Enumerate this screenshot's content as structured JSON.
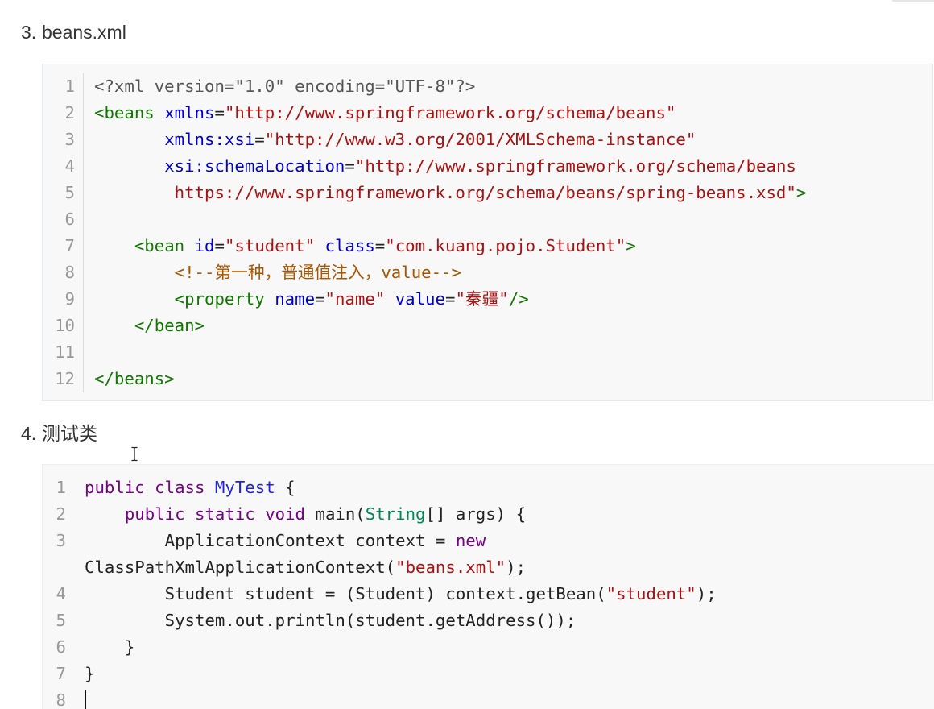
{
  "theme": {
    "page_background": "#ffffff",
    "text": "#333333",
    "code_background": "#f8f8f8",
    "code_border": "#e7eaed",
    "line_number": "#999999",
    "gutter_border": "#dddddd"
  },
  "document": {
    "sections": [
      {
        "marker": "3.",
        "title": "beans.xml",
        "code": {
          "lines": [
            {
              "n": 1,
              "tokens": [
                [
                  "<?xml version=\"1.0\" encoding=\"UTF-8\"?>",
                  "#555555"
                ]
              ]
            },
            {
              "n": 2,
              "tokens": [
                [
                  "<beans",
                  "#117700"
                ],
                [
                  " xmlns",
                  "#0000cc"
                ],
                [
                  "=",
                  "#222222"
                ],
                [
                  "\"http://www.springframework.org/schema/beans\"",
                  "#aa1111"
                ]
              ]
            },
            {
              "n": 3,
              "tokens": [
                [
                  "       xmlns:xsi",
                  "#0000cc"
                ],
                [
                  "=",
                  "#222222"
                ],
                [
                  "\"http://www.w3.org/2001/XMLSchema-instance\"",
                  "#aa1111"
                ]
              ]
            },
            {
              "n": 4,
              "tokens": [
                [
                  "       xsi:schemaLocation",
                  "#0000cc"
                ],
                [
                  "=",
                  "#222222"
                ],
                [
                  "\"http://www.springframework.org/schema/beans",
                  "#aa1111"
                ]
              ]
            },
            {
              "n": 5,
              "tokens": [
                [
                  "        https://www.springframework.org/schema/beans/spring-beans.xsd\"",
                  "#aa1111"
                ],
                [
                  ">",
                  "#117700"
                ]
              ]
            },
            {
              "n": 6,
              "tokens": []
            },
            {
              "n": 7,
              "tokens": [
                [
                  "    <bean",
                  "#117700"
                ],
                [
                  " id",
                  "#0000cc"
                ],
                [
                  "=",
                  "#222222"
                ],
                [
                  "\"student\"",
                  "#aa1111"
                ],
                [
                  " class",
                  "#0000cc"
                ],
                [
                  "=",
                  "#222222"
                ],
                [
                  "\"com.kuang.pojo.Student\"",
                  "#aa1111"
                ],
                [
                  ">",
                  "#117700"
                ]
              ]
            },
            {
              "n": 8,
              "tokens": [
                [
                  "        <!--第一种，普通值注入，value-->",
                  "#aa5500"
                ]
              ]
            },
            {
              "n": 9,
              "tokens": [
                [
                  "        <property",
                  "#117700"
                ],
                [
                  " name",
                  "#0000cc"
                ],
                [
                  "=",
                  "#222222"
                ],
                [
                  "\"name\"",
                  "#aa1111"
                ],
                [
                  " value",
                  "#0000cc"
                ],
                [
                  "=",
                  "#222222"
                ],
                [
                  "\"秦疆\"",
                  "#aa1111"
                ],
                [
                  "/>",
                  "#117700"
                ]
              ]
            },
            {
              "n": 10,
              "tokens": [
                [
                  "    </bean>",
                  "#117700"
                ]
              ]
            },
            {
              "n": 11,
              "tokens": []
            },
            {
              "n": 12,
              "tokens": [
                [
                  "</beans>",
                  "#117700"
                ]
              ]
            }
          ]
        }
      },
      {
        "marker": "4.",
        "title": "测试类",
        "code": {
          "lines": [
            {
              "n": 1,
              "tokens": [
                [
                  "public class",
                  "#770088"
                ],
                [
                  " MyTest",
                  "#2222dd"
                ],
                [
                  " {",
                  "#222222"
                ]
              ]
            },
            {
              "n": 2,
              "tokens": [
                [
                  "    public static void",
                  "#770088"
                ],
                [
                  " main(",
                  "#222222"
                ],
                [
                  "String",
                  "#008855"
                ],
                [
                  "[] args) {",
                  "#222222"
                ]
              ]
            },
            {
              "n": 3,
              "tokens": [
                [
                  "        ApplicationContext context = ",
                  "#222222"
                ],
                [
                  "new",
                  "#770088"
                ],
                [
                  " ClassPathXmlApplicationContext(",
                  "#222222"
                ],
                [
                  "\"beans.xml\"",
                  "#aa1111"
                ],
                [
                  ");",
                  "#222222"
                ]
              ]
            },
            {
              "n": 4,
              "tokens": [
                [
                  "        Student student = (Student) context.getBean(",
                  "#222222"
                ],
                [
                  "\"student\"",
                  "#aa1111"
                ],
                [
                  ");",
                  "#222222"
                ]
              ]
            },
            {
              "n": 5,
              "tokens": [
                [
                  "        System.out.println(student.getAddress());",
                  "#222222"
                ]
              ]
            },
            {
              "n": 6,
              "tokens": [
                [
                  "    }",
                  "#222222"
                ]
              ]
            },
            {
              "n": 7,
              "tokens": [
                [
                  "}",
                  "#222222"
                ]
              ]
            },
            {
              "n": 8,
              "tokens": [],
              "caret": true
            }
          ]
        }
      }
    ]
  }
}
